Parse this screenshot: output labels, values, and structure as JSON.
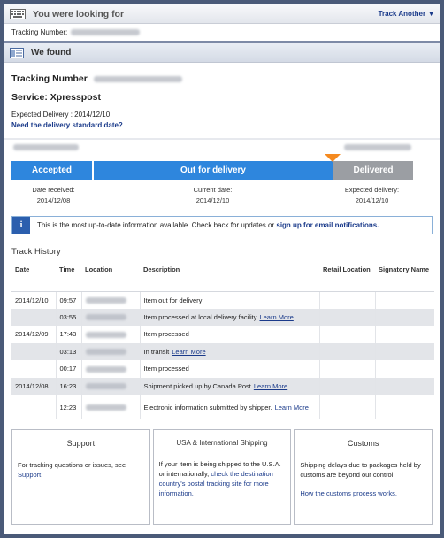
{
  "looking": {
    "title": "You were looking for",
    "track_another": "Track Another",
    "tracking_label": "Tracking Number:"
  },
  "found": {
    "title": "We found",
    "tracking_label": "Tracking Number",
    "service": "Service: Xpresspost",
    "expected_label": "Expected Delivery :",
    "expected_value": "2014/12/10",
    "need_link": "Need the delivery standard date?"
  },
  "progress": {
    "accepted": "Accepted",
    "out_for_delivery": "Out for delivery",
    "delivered": "Delivered",
    "date_received_label": "Date received:",
    "date_received": "2014/12/08",
    "current_date_label": "Current date:",
    "current_date": "2014/12/10",
    "expected_delivery_label": "Expected delivery:",
    "expected_delivery": "2014/12/10"
  },
  "notice": {
    "icon": "i",
    "text": "This is the most up-to-date information available. Check back for updates or",
    "link": "sign up for email notifications."
  },
  "history": {
    "title": "Track History",
    "headers": [
      "Date",
      "Time",
      "Location",
      "Description",
      "Retail Location",
      "Signatory Name"
    ],
    "rows": [
      {
        "date": "2014/12/10",
        "time": "09:57",
        "desc": "Item out for delivery",
        "more": ""
      },
      {
        "date": "",
        "time": "03:55",
        "desc": "Item processed at local delivery facility",
        "more": "Learn More"
      },
      {
        "date": "2014/12/09",
        "time": "17:43",
        "desc": "Item processed",
        "more": ""
      },
      {
        "date": "",
        "time": "03:13",
        "desc": "In transit",
        "more": "Learn More"
      },
      {
        "date": "",
        "time": "00:17",
        "desc": "Item processed",
        "more": ""
      },
      {
        "date": "2014/12/08",
        "time": "16:23",
        "desc": "Shipment picked up by Canada Post",
        "more": "Learn More"
      },
      {
        "date": "",
        "time": "12:23",
        "desc": "Electronic information submitted by shipper.",
        "more": "Learn More"
      }
    ]
  },
  "boxes": {
    "support_title": "Support",
    "support_text": "For tracking questions or issues, see",
    "support_link": "Support",
    "usa_title": "USA & International Shipping",
    "usa_text": "If your item is being shipped to the U.S.A. or internationally,",
    "usa_link": "check the destination country's postal tracking site for more information.",
    "customs_title": "Customs",
    "customs_text": "Shipping delays due to packages held by customs are beyond our control.",
    "customs_link": "How the customs process works."
  }
}
